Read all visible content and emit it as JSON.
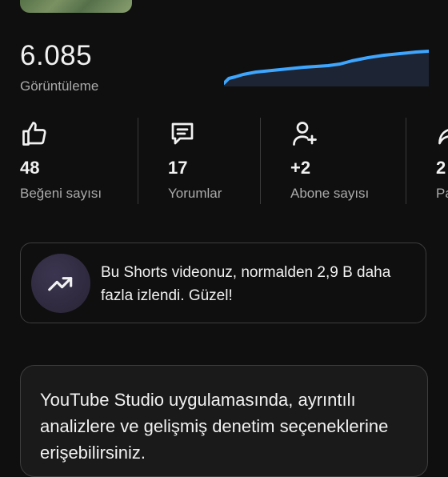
{
  "summary": {
    "views_value": "6.085",
    "views_label": "Görüntüleme",
    "sparkline_color": "#3ea6ff"
  },
  "stats": [
    {
      "icon": "thumbs-up-icon",
      "value": "48",
      "label": "Beğeni sayısı"
    },
    {
      "icon": "comment-icon",
      "value": "17",
      "label": "Yorumlar"
    },
    {
      "icon": "add-person-icon",
      "value": "+2",
      "label": "Abone sayısı"
    },
    {
      "icon": "share-icon",
      "value": "2",
      "label": "Pa"
    }
  ],
  "insight": {
    "icon": "trending-up-icon",
    "text": "Bu Shorts videonuz, normalden 2,9 B daha fazla izlendi. Güzel!"
  },
  "studio_promo": {
    "text": "YouTube Studio uygulamasında, ayrıntılı analizlere ve gelişmiş denetim seçeneklerine erişebilirsiniz."
  }
}
